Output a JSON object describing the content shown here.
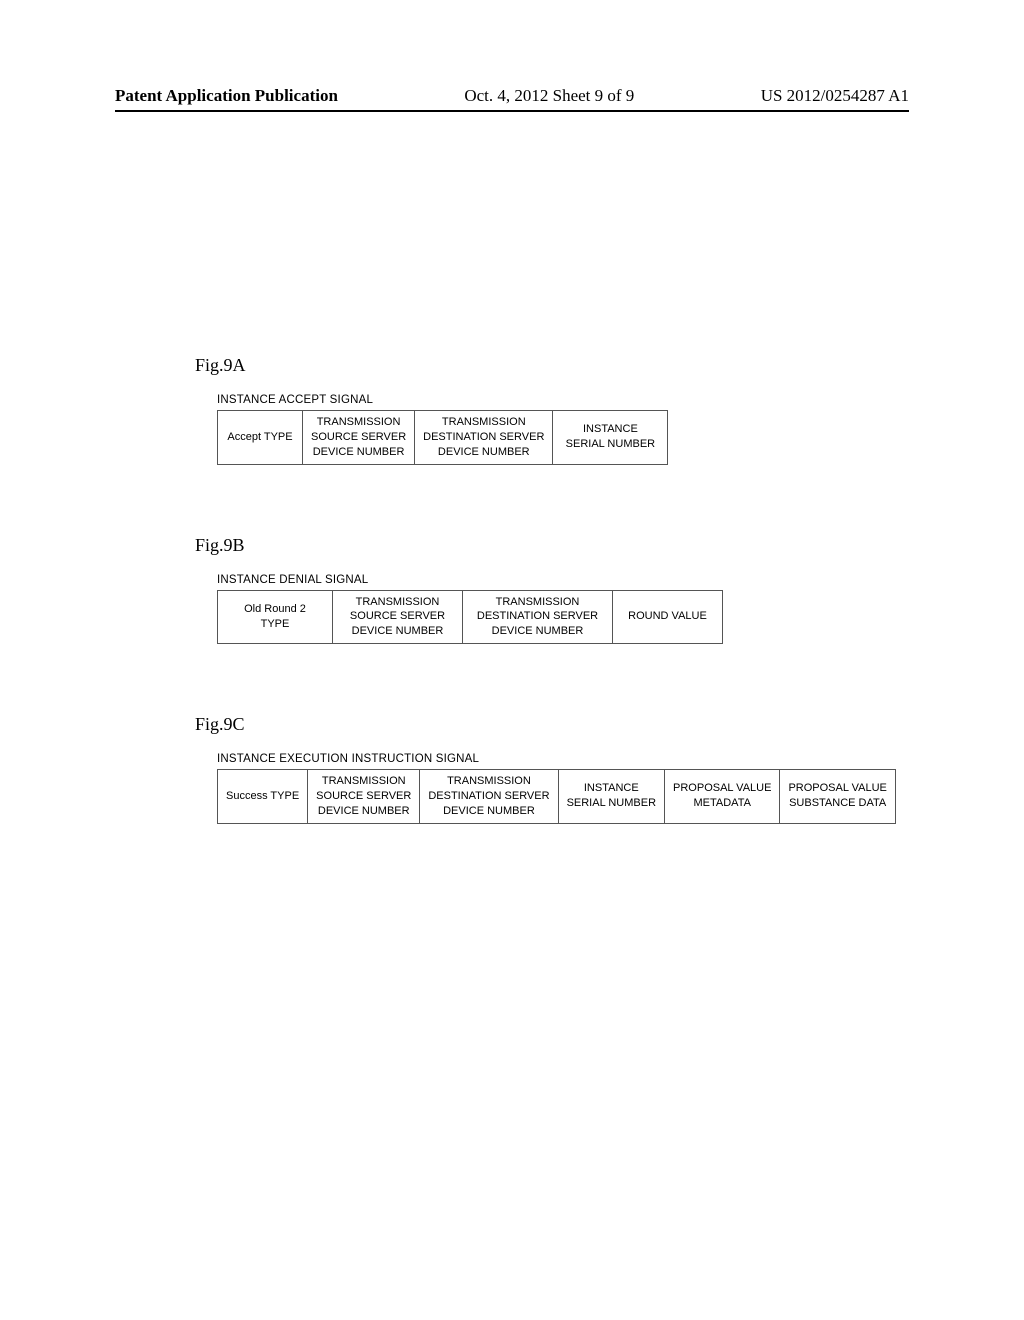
{
  "header": {
    "left": "Patent Application Publication",
    "center": "Oct. 4, 2012  Sheet 9 of 9",
    "right": "US 2012/0254287 A1"
  },
  "figA": {
    "label": "Fig.9A",
    "title": "INSTANCE ACCEPT SIGNAL",
    "cells": {
      "type": "Accept TYPE",
      "src": "TRANSMISSION\nSOURCE SERVER\nDEVICE NUMBER",
      "dst": "TRANSMISSION\nDESTINATION SERVER\nDEVICE NUMBER",
      "last": "INSTANCE\nSERIAL NUMBER"
    }
  },
  "figB": {
    "label": "Fig.9B",
    "title": "INSTANCE DENIAL SIGNAL",
    "cells": {
      "type": "Old Round 2\nTYPE",
      "src": "TRANSMISSION\nSOURCE SERVER\nDEVICE NUMBER",
      "dst": "TRANSMISSION\nDESTINATION SERVER\nDEVICE NUMBER",
      "last": "ROUND VALUE"
    }
  },
  "figC": {
    "label": "Fig.9C",
    "title": "INSTANCE EXECUTION INSTRUCTION SIGNAL",
    "cells": {
      "type": "Success TYPE",
      "src": "TRANSMISSION\nSOURCE SERVER\nDEVICE NUMBER",
      "dst": "TRANSMISSION\nDESTINATION SERVER\nDEVICE NUMBER",
      "inst": "INSTANCE\nSERIAL NUMBER",
      "pv1": "PROPOSAL VALUE\nMETADATA",
      "pv2": "PROPOSAL VALUE\nSUBSTANCE DATA"
    }
  }
}
